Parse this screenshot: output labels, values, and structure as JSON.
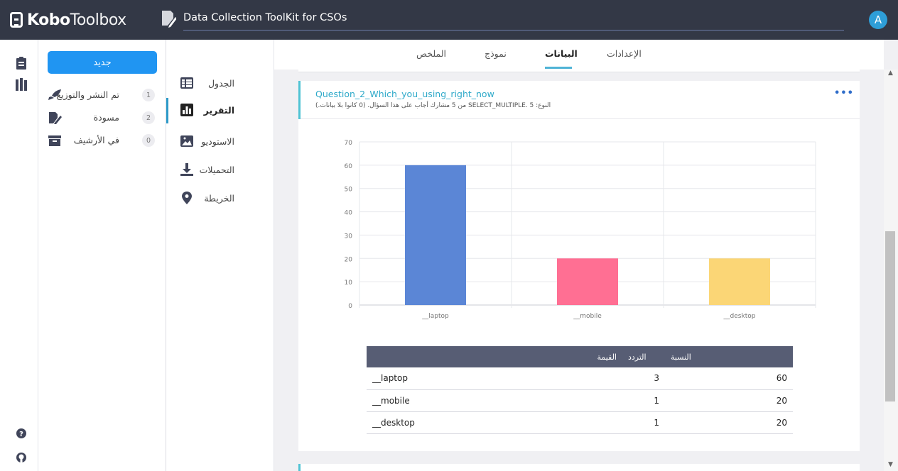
{
  "header": {
    "logo_bold": "Kobo",
    "logo_light": "Toolbox",
    "project_title": "Data Collection ToolKit for CSOs",
    "avatar_letter": "A"
  },
  "drawer": {
    "new_button": "جديد",
    "items": [
      {
        "label": "تم النشر والتوزيع",
        "count": "1",
        "icon": "rocket-icon"
      },
      {
        "label": "مسودة",
        "count": "2",
        "icon": "draft-icon"
      },
      {
        "label": "في الأرشيف",
        "count": "0",
        "icon": "archive-icon"
      }
    ]
  },
  "subnav": {
    "items": [
      {
        "label": "الجدول",
        "icon": "table-icon",
        "active": false
      },
      {
        "label": "التقرير",
        "icon": "report-icon",
        "active": true
      },
      {
        "label": "الاستوديو",
        "icon": "gallery-icon",
        "active": false
      },
      {
        "label": "التحميلات",
        "icon": "download-icon",
        "active": false
      },
      {
        "label": "الخريطة",
        "icon": "map-pin-icon",
        "active": false
      }
    ]
  },
  "tabs": {
    "settings": "الإعدادات",
    "data": "البيانات",
    "form": "نموذج",
    "summary": "الملخص",
    "active": "data"
  },
  "question": {
    "title": "Question_2_Which_you_using_right_now",
    "subtitle": "من 5 مشارك أجاب على هذا السؤال. (0 كانوا بلا بيانات.) SELECT_MULTIPLE. 5 :النوع"
  },
  "chart_data": {
    "type": "bar",
    "categories": [
      "__laptop",
      "__mobile",
      "__desktop"
    ],
    "values": [
      60,
      20,
      20
    ],
    "colors": [
      "#5b86d6",
      "#ff6f93",
      "#fbd676"
    ],
    "ylim": [
      0,
      70
    ],
    "yticks": [
      "0",
      "10",
      "20",
      "30",
      "40",
      "50",
      "60",
      "70"
    ],
    "grid": true,
    "title": "",
    "xlabel": "",
    "ylabel": ""
  },
  "table": {
    "headers": {
      "value": "القيمة",
      "frequency": "التردد",
      "percentage": "النسبة"
    },
    "rows": [
      {
        "value": "__laptop",
        "frequency": "3",
        "percentage": "60"
      },
      {
        "value": "__mobile",
        "frequency": "1",
        "percentage": "20"
      },
      {
        "value": "__desktop",
        "frequency": "1",
        "percentage": "20"
      }
    ]
  },
  "colors": {
    "header_bg": "#333846",
    "primary": "#2095f2",
    "accent": "#4fc3d4",
    "table_header": "#575d74"
  }
}
